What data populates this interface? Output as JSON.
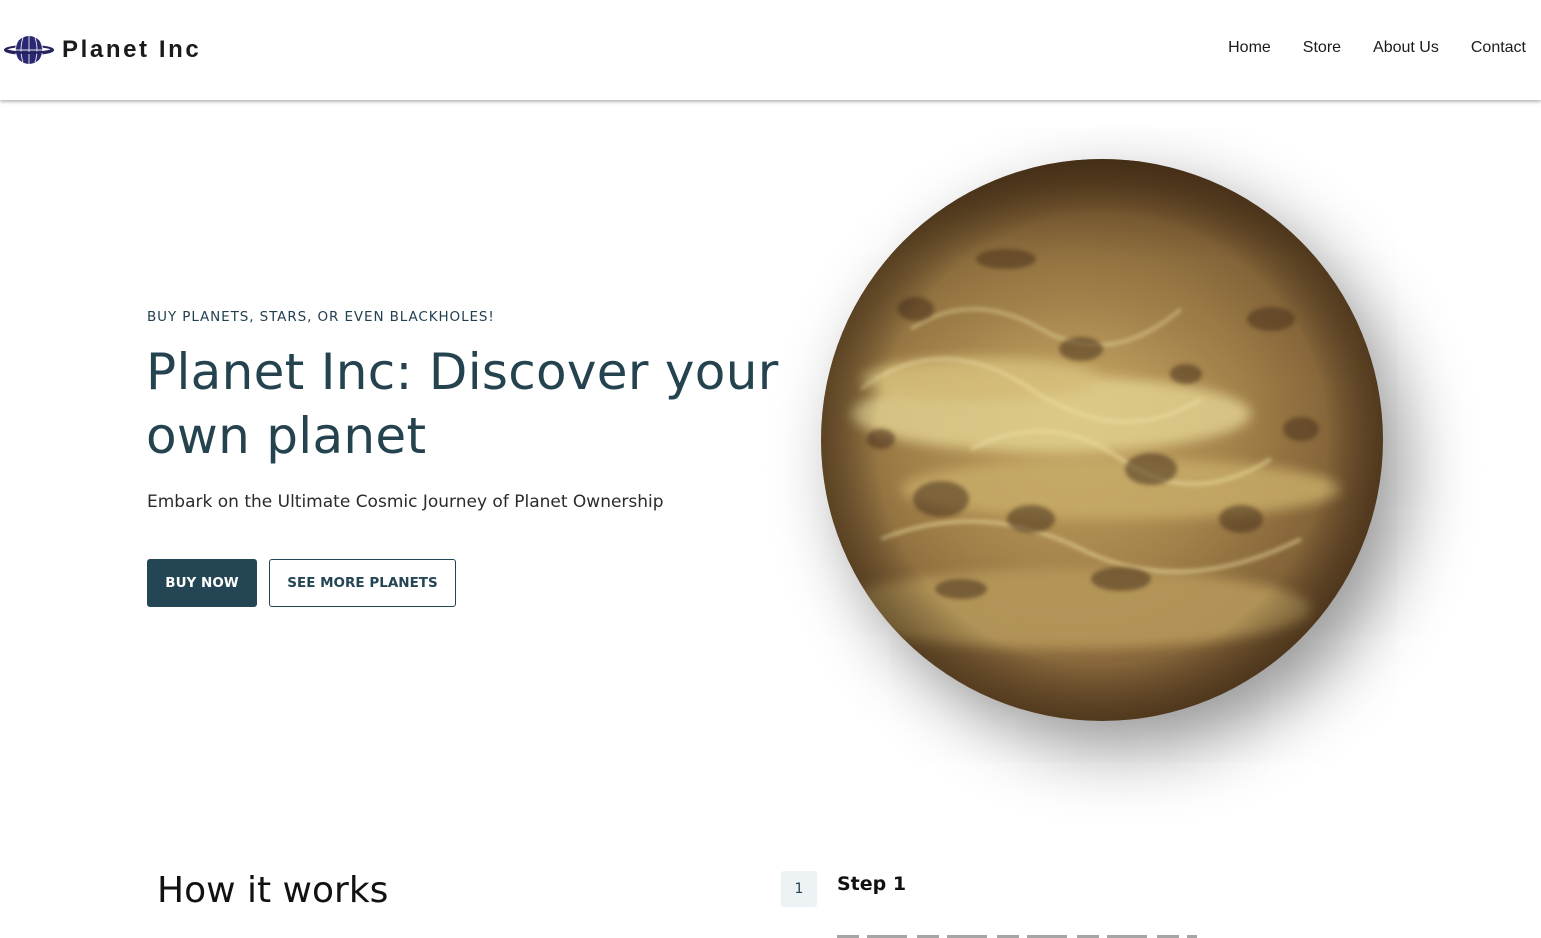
{
  "header": {
    "brand_name": "Planet Inc",
    "logo_icon": "planet-logo-icon",
    "nav": {
      "home": "Home",
      "store": "Store",
      "about": "About Us",
      "contact": "Contact"
    }
  },
  "hero": {
    "eyebrow": "BUY PLANETS, STARS, OR EVEN BLACKHOLES!",
    "title": "Planet Inc: Discover your own planet",
    "subtitle": "Embark on the Ultimate Cosmic Journey of Planet Ownership",
    "buy_button": "BUY NOW",
    "more_button": "SEE MORE PLANETS",
    "image_icon": "planet-image"
  },
  "how_it_works": {
    "title": "How it works",
    "steps": [
      {
        "number": "1",
        "title": "Step 1"
      }
    ]
  },
  "colors": {
    "primary": "#244554",
    "eyebrow": "#24404f",
    "step_badge_bg": "#edf3f5",
    "planet_base": "#8a6a3c"
  }
}
